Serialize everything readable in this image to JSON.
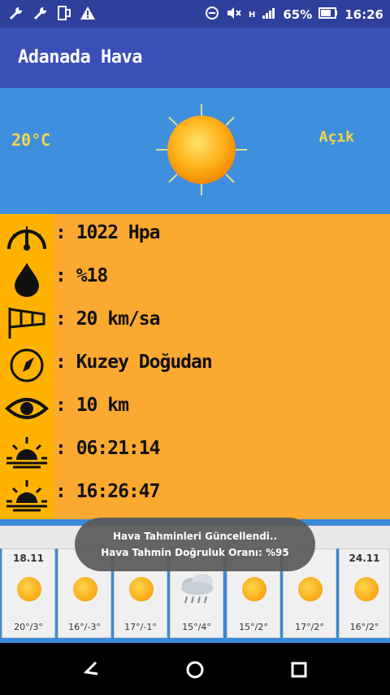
{
  "status": {
    "battery_percent": "65%",
    "time": "16:26",
    "network_type": "H"
  },
  "app": {
    "title": "Adanada Hava"
  },
  "current": {
    "temperature": "20°C",
    "condition": "Açık",
    "icon": "sun-icon"
  },
  "details": [
    {
      "icon": "pressure-gauge-icon",
      "value": ": 1022 Hpa"
    },
    {
      "icon": "humidity-drop-icon",
      "value": ": %18"
    },
    {
      "icon": "windsock-icon",
      "value": ": 20 km/sa"
    },
    {
      "icon": "compass-icon",
      "value": ": Kuzey Doğudan"
    },
    {
      "icon": "visibility-eye-icon",
      "value": ": 10 km"
    },
    {
      "icon": "sunrise-icon",
      "value": ": 06:21:14"
    },
    {
      "icon": "sunset-icon",
      "value": ": 16:26:47"
    }
  ],
  "forecast": [
    {
      "date": "18.11",
      "icon": "sun-icon",
      "range": "20°/3°"
    },
    {
      "date": "",
      "icon": "sun-icon",
      "range": "16°/-3°"
    },
    {
      "date": "",
      "icon": "sun-icon",
      "range": "17°/-1°"
    },
    {
      "date": "",
      "icon": "rain-cloud-icon",
      "range": "15°/4°"
    },
    {
      "date": "",
      "icon": "sun-icon",
      "range": "15°/2°"
    },
    {
      "date": "",
      "icon": "sun-icon",
      "range": "17°/2°"
    },
    {
      "date": "24.11",
      "icon": "sun-icon",
      "range": "16°/2°"
    }
  ],
  "toast": {
    "line1": "Hava Tahminleri Güncellendi..",
    "line2": "Hava Tahmin Doğruluk Oranı: %95"
  },
  "colors": {
    "status_bar": "#2f3f9c",
    "app_bar": "#3b4fb8",
    "hero_bg": "#3f8fdf",
    "details_bg": "#fba930",
    "accent_text": "#f5d54a"
  }
}
